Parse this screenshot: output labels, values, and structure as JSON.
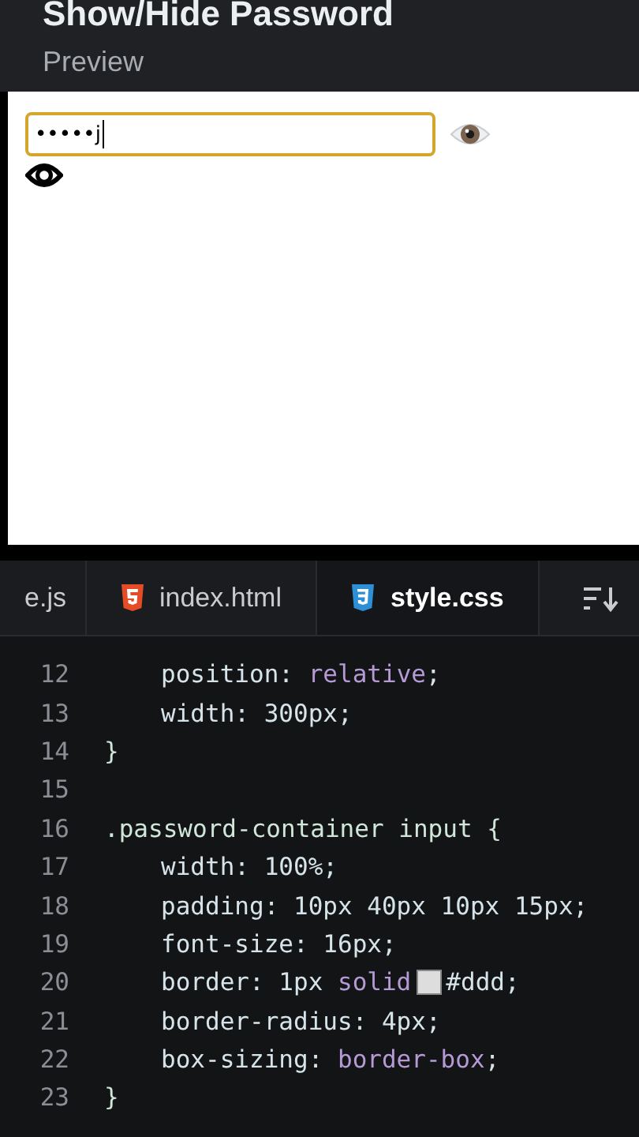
{
  "preview_header": {
    "title": "Show/Hide Password",
    "subtitle": "Preview"
  },
  "preview": {
    "password_field": {
      "value": "•••••j",
      "focused": true
    }
  },
  "editor_tabs": [
    {
      "label": "e.js",
      "selected": false
    },
    {
      "label": "index.html",
      "selected": false
    },
    {
      "label": "style.css",
      "selected": true
    }
  ],
  "code_lines": [
    {
      "number": "12",
      "kind": "declaration",
      "tokens": [
        {
          "kind": "prop",
          "text": "position: "
        },
        {
          "kind": "keyword",
          "text": "relative"
        },
        {
          "kind": "prop",
          "text": ";"
        }
      ]
    },
    {
      "number": "13",
      "kind": "declaration",
      "tokens": [
        {
          "kind": "prop",
          "text": "width: 300px;"
        }
      ]
    },
    {
      "number": "14",
      "kind": "rule",
      "tokens": [
        {
          "kind": "selector",
          "text": "}"
        }
      ]
    },
    {
      "number": "15",
      "kind": "blank"
    },
    {
      "number": "16",
      "kind": "rule",
      "tokens": [
        {
          "kind": "selector",
          "text": ".password-container input {"
        }
      ]
    },
    {
      "number": "17",
      "kind": "declaration",
      "tokens": [
        {
          "kind": "prop",
          "text": "width: 100%;"
        }
      ]
    },
    {
      "number": "18",
      "kind": "declaration",
      "tokens": [
        {
          "kind": "prop",
          "text": "padding: 10px 40px 10px 15px;"
        }
      ]
    },
    {
      "number": "19",
      "kind": "declaration",
      "tokens": [
        {
          "kind": "prop",
          "text": "font-size: 16px;"
        }
      ]
    },
    {
      "number": "20",
      "kind": "declaration",
      "tokens": [
        {
          "kind": "prop",
          "text": "border: 1px "
        },
        {
          "kind": "keyword",
          "text": "solid"
        },
        {
          "kind": "swatch",
          "color": "#dddddd"
        },
        {
          "kind": "prop",
          "text": "#ddd;"
        }
      ]
    },
    {
      "number": "21",
      "kind": "declaration",
      "tokens": [
        {
          "kind": "prop",
          "text": "border-radius: 4px;"
        }
      ]
    },
    {
      "number": "22",
      "kind": "declaration",
      "tokens": [
        {
          "kind": "prop",
          "text": "box-sizing: "
        },
        {
          "kind": "keyword",
          "text": "border-box"
        },
        {
          "kind": "prop",
          "text": ";"
        }
      ]
    },
    {
      "number": "23",
      "kind": "rule",
      "tokens": [
        {
          "kind": "selector",
          "text": "}"
        }
      ]
    }
  ]
}
